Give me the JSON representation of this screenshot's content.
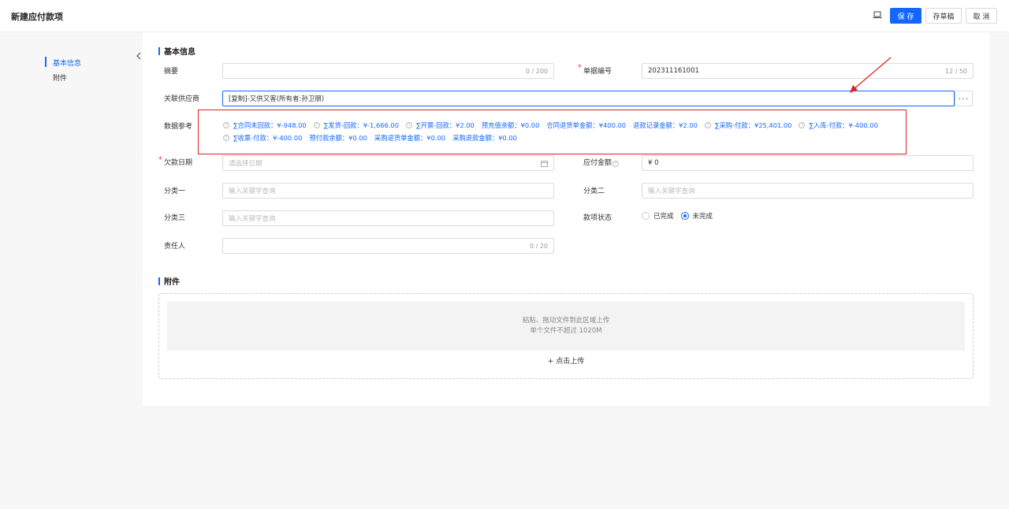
{
  "header": {
    "title": "新建应付款项",
    "save_label": "保 存",
    "draft_label": "存草稿",
    "cancel_label": "取 消"
  },
  "anchor_nav": {
    "items": [
      "基本信息",
      "附件"
    ]
  },
  "basic_info": {
    "section_title": "基本信息",
    "summary": {
      "label": "摘要",
      "value": "",
      "count": "0 / 200"
    },
    "doc_no": {
      "label": "单据编号",
      "value": "202311161001",
      "count": "12 / 50"
    },
    "supplier": {
      "label": "关联供应商",
      "value": "[复制]-又供又客(所有者:孙卫朋)",
      "more": "···"
    },
    "data_ref": {
      "label": "数据参考",
      "row1": [
        {
          "text": "∑合同未回款：¥-948.00",
          "help": true
        },
        {
          "text": "∑发货-回款：¥-1,666.00",
          "help": true
        },
        {
          "text": "∑开票-回款：¥2.00",
          "help": true
        },
        {
          "text": "预充值余额：¥0.00",
          "help": false
        },
        {
          "text": "合同退货单金额：¥400.00",
          "help": false
        },
        {
          "text": "退款记录金额：¥2.00",
          "help": false
        },
        {
          "text": "∑采购-付款：¥25,401.00",
          "help": true
        },
        {
          "text": "∑入库-付款：¥-400.00",
          "help": true
        }
      ],
      "row2": [
        {
          "text": "∑收票-付款：¥-400.00",
          "help": true
        },
        {
          "text": "预付款余额：¥0.00",
          "help": false
        },
        {
          "text": "采购退货单金额：¥0.00",
          "help": false
        },
        {
          "text": "采购退款金额：¥0.00",
          "help": false
        }
      ]
    },
    "debt_date": {
      "label": "欠款日期",
      "placeholder": "请选择日期"
    },
    "amount": {
      "label": "应付金额",
      "value": "¥ 0"
    },
    "cat1": {
      "label": "分类一",
      "placeholder": "输入关键字查询"
    },
    "cat2": {
      "label": "分类二",
      "placeholder": "输入关键字查询"
    },
    "cat3": {
      "label": "分类三",
      "placeholder": "输入关键字查询"
    },
    "status": {
      "label": "款项状态",
      "options": [
        "已完成",
        "未完成"
      ],
      "selected": "未完成"
    },
    "owner": {
      "label": "责任人",
      "value": "",
      "count": "0 / 20"
    }
  },
  "attachments": {
    "section_title": "附件",
    "hint1": "粘贴、拖动文件到此区域上传",
    "hint2": "单个文件不超过 1020M",
    "upload_label": "+ 点击上传"
  },
  "colors": {
    "primary": "#1367ff",
    "highlight": "#e02020"
  }
}
